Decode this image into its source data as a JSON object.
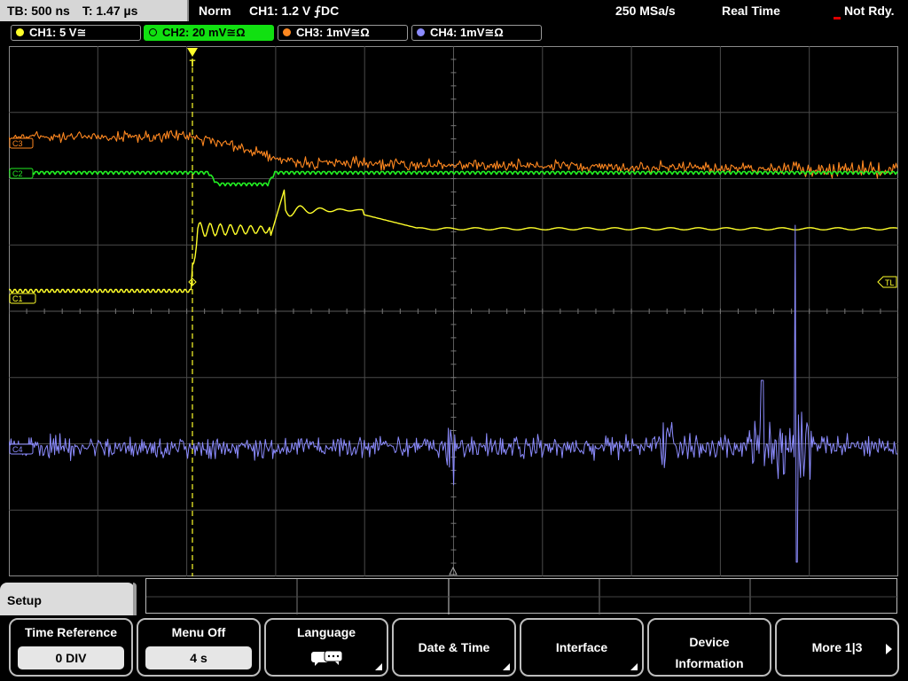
{
  "status_bar": {
    "timebase": "TB: 500 ns",
    "trigger_time": "T: 1.47 µs",
    "mode": "Norm",
    "trigger_setting": "CH1: 1.2 V ⨍DC",
    "sample_rate": "250 MSa/s",
    "acq_mode": "Real Time",
    "state": "Not Rdy."
  },
  "channels": [
    {
      "label": "CH1: 5 V≅",
      "color": "#ffff2a"
    },
    {
      "label": "CH2: 20 mV≅Ω",
      "color": "#22ee22"
    },
    {
      "label": "CH3: 1mV≅Ω",
      "color": "#ff8820"
    },
    {
      "label": "CH4: 1mV≅Ω",
      "color": "#8c8cff"
    }
  ],
  "markers": {
    "ch1": "C1",
    "ch2": "C2",
    "ch3": "C3",
    "ch4": "C4",
    "trigger_level": "TL",
    "trigger_point": "T"
  },
  "colors": {
    "grid": "#4a4a4a",
    "grid_minor": "#777777",
    "trigger_marker": "#ffff2a",
    "background": "#000000"
  },
  "menu": {
    "title": "Setup",
    "softkeys": [
      {
        "title": "Time Reference",
        "value": "0 DIV"
      },
      {
        "title": "Menu Off",
        "value": "4 s"
      },
      {
        "title": "Language",
        "icon": "speech-bubbles-icon"
      },
      {
        "title": "Date & Time"
      },
      {
        "title": "Interface"
      },
      {
        "title_line1": "Device",
        "title_line2": "Information"
      },
      {
        "title": "More 1|3"
      }
    ]
  }
}
